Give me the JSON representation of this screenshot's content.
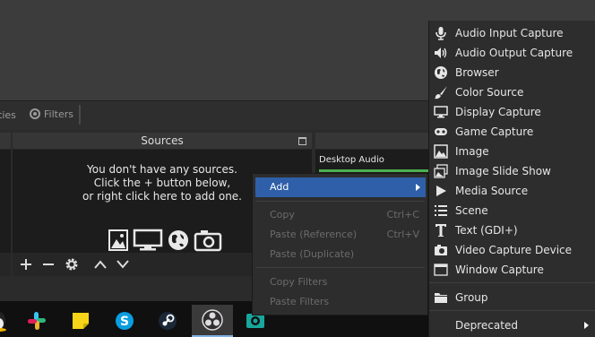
{
  "toolbar": {
    "properties_label": "ties",
    "filters_label": "Filters"
  },
  "sources": {
    "title": "Sources",
    "empty_lines": [
      "You don't have any sources.",
      "Click the + button below,",
      "or right click here to add one."
    ]
  },
  "mixer": {
    "track_label": "Desktop Audio"
  },
  "context_menu": {
    "add": "Add",
    "copy": "Copy",
    "copy_shortcut": "Ctrl+C",
    "paste_reference": "Paste (Reference)",
    "paste_reference_shortcut": "Ctrl+V",
    "paste_duplicate": "Paste (Duplicate)",
    "copy_filters": "Copy Filters",
    "paste_filters": "Paste Filters"
  },
  "add_submenu": {
    "items": [
      {
        "label": "Audio Input Capture",
        "icon": "microphone-icon"
      },
      {
        "label": "Audio Output Capture",
        "icon": "speaker-icon"
      },
      {
        "label": "Browser",
        "icon": "globe-icon"
      },
      {
        "label": "Color Source",
        "icon": "brush-icon"
      },
      {
        "label": "Display Capture",
        "icon": "monitor-icon"
      },
      {
        "label": "Game Capture",
        "icon": "gamepad-icon"
      },
      {
        "label": "Image",
        "icon": "image-icon"
      },
      {
        "label": "Image Slide Show",
        "icon": "slideshow-icon"
      },
      {
        "label": "Media Source",
        "icon": "play-icon"
      },
      {
        "label": "Scene",
        "icon": "list-icon"
      },
      {
        "label": "Text (GDI+)",
        "icon": "text-icon"
      },
      {
        "label": "Video Capture Device",
        "icon": "camera-icon"
      },
      {
        "label": "Window Capture",
        "icon": "window-icon"
      }
    ],
    "group": "Group",
    "deprecated": "Deprecated"
  },
  "taskbar": {
    "apps": [
      "linux-icon",
      "slack-icon",
      "sticky-notes-icon",
      "skype-icon",
      "steam-icon",
      "obs-icon",
      "cam-app-icon"
    ]
  },
  "colors": {
    "highlight": "#2f5fa8",
    "meter_green": "#4caf50"
  }
}
